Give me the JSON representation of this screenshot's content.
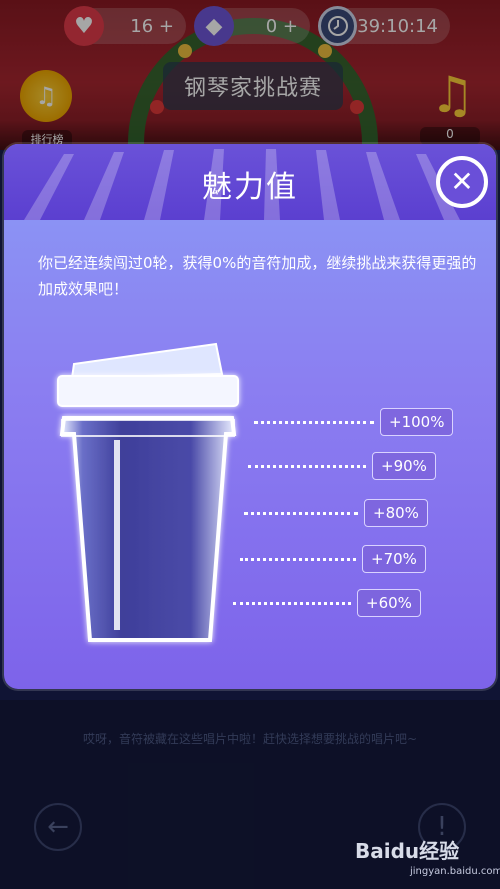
{
  "top_bar": {
    "hearts": "16 +",
    "gems": "0 +",
    "timer": "39:10:14"
  },
  "banner": {
    "title": "钢琴家挑战赛"
  },
  "rank": {
    "label": "排行榜"
  },
  "music": {
    "count": "0"
  },
  "modal": {
    "title": "魅力值",
    "close_symbol": "✕",
    "description": "你已经连续闯过0轮，获得0%的音符加成，继续挑战来获得更强的加成效果吧！",
    "levels": [
      "+100%",
      "+90%",
      "+80%",
      "+70%",
      "+60%"
    ],
    "fill_level": 0
  },
  "footer": {
    "hint": "哎呀，音符被藏在这些唱片中啦！赶快选择想要挑战的唱片吧~",
    "back_symbol": "←",
    "info_symbol": "!"
  },
  "watermark": {
    "brand": "Baidu经验",
    "url": "jingyan.baidu.com"
  },
  "icons": {
    "hearts": "heart-icon",
    "gems": "diamond-icon",
    "timer": "clock-icon",
    "rank": "trophy-icon",
    "music": "music-note-icon"
  },
  "colors": {
    "modal_header": "#5b3fd0",
    "modal_body": "#8b7ef1",
    "badge_bg": "#7d64dc",
    "background": "#1a2050"
  }
}
